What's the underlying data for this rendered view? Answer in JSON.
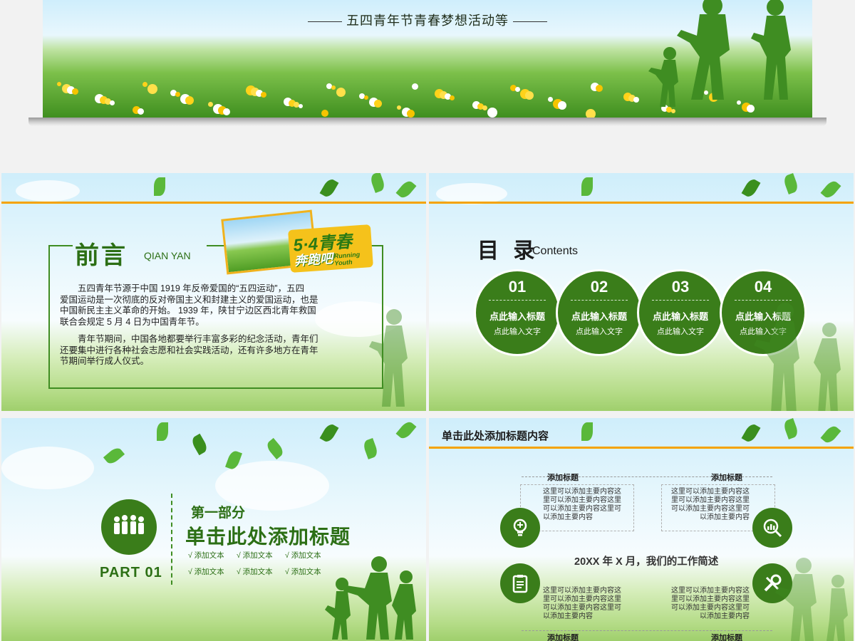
{
  "top_banner": {
    "title": "五四青年节青春梦想活动等"
  },
  "preface": {
    "title": "前言",
    "subtitle": "QIAN YAN",
    "paragraph1_lines": [
      "五四青年节源于中国 1919 年反帝爱国的“五四运动”，五四",
      "爱国运动是一次彻底的反对帝国主义和封建主义的爱国运动，也是",
      "中国新民主主义革命的开始。 1939 年，陕甘宁边区西北青年救国",
      "联合会规定 5 月 4 日为中国青年节。"
    ],
    "paragraph2_lines": [
      "青年节期间，中国各地都要举行丰富多彩的纪念活动，青年们",
      "还要集中进行各种社会志愿和社会实践活动，还有许多地方在青年",
      "节期间举行成人仪式。"
    ],
    "logo": {
      "line1": "5·4青春",
      "line2": "奔跑吧",
      "line3": "Running Youth"
    }
  },
  "contents": {
    "title": "目 录",
    "subtitle": "Contents",
    "items": [
      {
        "num": "01",
        "title": "点此输入标题",
        "sub": "点此输入文字"
      },
      {
        "num": "02",
        "title": "点此输入标题",
        "sub": "点此输入文字"
      },
      {
        "num": "03",
        "title": "点此输入标题",
        "sub": "点此输入文字"
      },
      {
        "num": "04",
        "title": "点此输入标题",
        "sub": "点此输入文字"
      }
    ]
  },
  "part": {
    "part_label": "PART 01",
    "heading1": "第一部分",
    "heading2": "单击此处添加标题",
    "items": [
      "√ 添加文本",
      "√ 添加文本",
      "√ 添加文本",
      "√ 添加文本",
      "√ 添加文本",
      "√ 添加文本"
    ]
  },
  "work": {
    "title": "单击此处添加标题内容",
    "center": "20XX 年 X 月，我们的工作简述",
    "blocks": [
      {
        "head": "添加标题",
        "lines": [
          "这里可以添加主要内容这",
          "里可以添加主要内容这里",
          "可以添加主要内容这里可",
          "以添加主要内容"
        ]
      },
      {
        "head": "添加标题",
        "lines": [
          "这里可以添加主要内容这",
          "里可以添加主要内容这里",
          "可以添加主要内容这里可",
          "以添加主要内容"
        ]
      },
      {
        "head": "添加标题",
        "lines": [
          "这里可以添加主要内容这",
          "里可以添加主要内容这里",
          "可以添加主要内容这里可",
          "以添加主要内容"
        ]
      },
      {
        "head": "添加标题",
        "lines": [
          "这里可以添加主要内容这",
          "里可以添加主要内容这里",
          "可以添加主要内容这里可",
          "以添加主要内容"
        ]
      }
    ],
    "icons": [
      "lightbulb-icon",
      "chart-search-icon",
      "clipboard-icon",
      "tools-icon"
    ]
  },
  "colors": {
    "primary_green": "#3a7d1a",
    "accent_orange": "#f4a300"
  }
}
